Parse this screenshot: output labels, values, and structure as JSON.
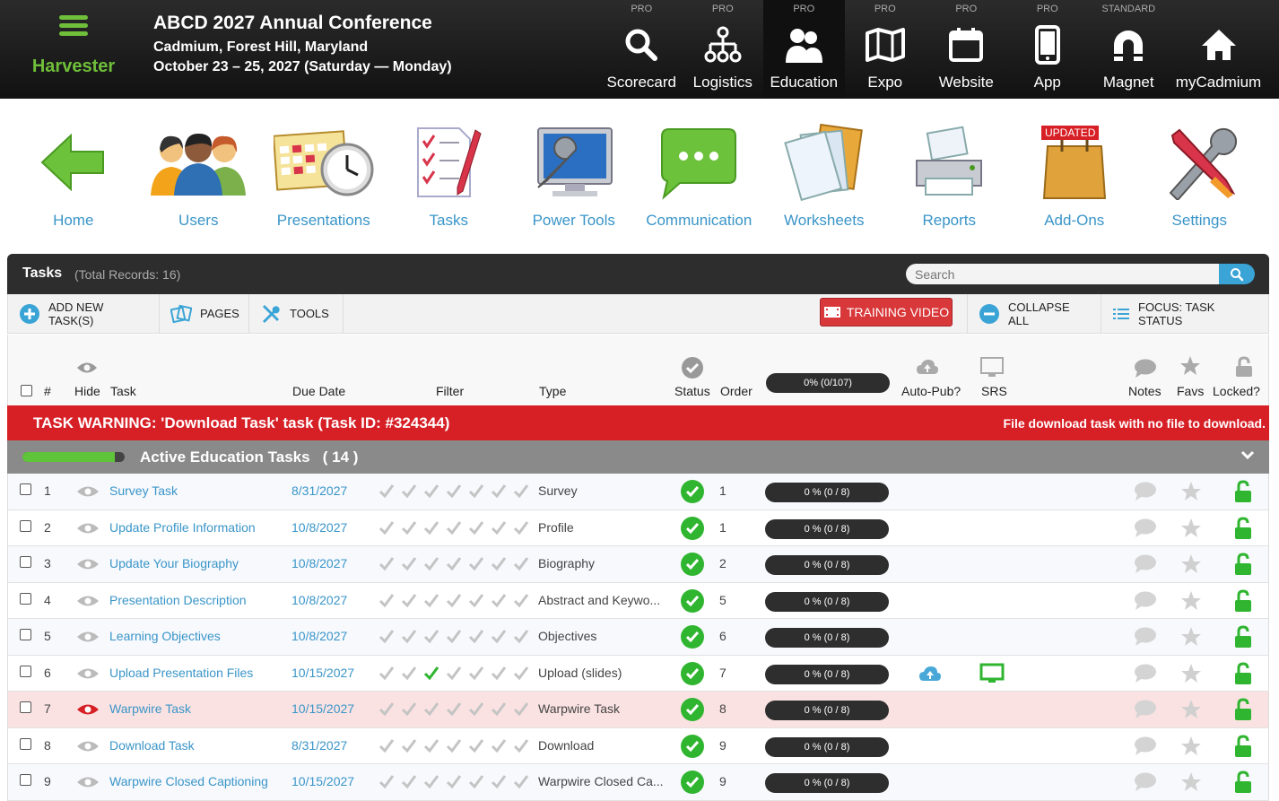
{
  "header": {
    "brand": "Harvester",
    "conference_title": "ABCD 2027 Annual Conference",
    "conference_location": "Cadmium, Forest Hill, Maryland",
    "conference_dates": "October 23 – 25, 2027 (Saturday — Monday)",
    "modules": [
      {
        "tier": "PRO",
        "label": "Scorecard",
        "icon": "search-icon"
      },
      {
        "tier": "PRO",
        "label": "Logistics",
        "icon": "org-chart-icon"
      },
      {
        "tier": "PRO",
        "label": "Education",
        "icon": "people-icon",
        "active": true
      },
      {
        "tier": "PRO",
        "label": "Expo",
        "icon": "map-icon"
      },
      {
        "tier": "PRO",
        "label": "Website",
        "icon": "calendar-icon"
      },
      {
        "tier": "PRO",
        "label": "App",
        "icon": "phone-icon"
      },
      {
        "tier": "STANDARD",
        "label": "Magnet",
        "icon": "magnet-icon"
      },
      {
        "tier": "",
        "label": "myCadmium",
        "icon": "home-icon"
      }
    ]
  },
  "appnav": {
    "items": [
      {
        "label": "Home",
        "icon": "back-arrow-icon"
      },
      {
        "label": "Users",
        "icon": "users-icon"
      },
      {
        "label": "Presentations",
        "icon": "calendar-clock-icon"
      },
      {
        "label": "Tasks",
        "icon": "checklist-icon"
      },
      {
        "label": "Power Tools",
        "icon": "monitor-wrench-icon"
      },
      {
        "label": "Communication",
        "icon": "chat-bubble-icon"
      },
      {
        "label": "Worksheets",
        "icon": "folders-icon"
      },
      {
        "label": "Reports",
        "icon": "printer-icon"
      },
      {
        "label": "Add-Ons",
        "icon": "shopping-bag-icon",
        "badge": "UPDATED"
      },
      {
        "label": "Settings",
        "icon": "tools-icon"
      }
    ]
  },
  "panel": {
    "title": "Tasks",
    "count": "(Total Records: 16)",
    "search_placeholder": "Search"
  },
  "toolbar": {
    "add": "ADD NEW TASK(S)",
    "pages": "PAGES",
    "tools": "TOOLS",
    "training": "TRAINING VIDEO",
    "collapse": "COLLAPSE ALL",
    "focus": "FOCUS: TASK STATUS"
  },
  "columns": {
    "num": "#",
    "hide": "Hide",
    "task": "Task",
    "due": "Due Date",
    "filter": "Filter",
    "type": "Type",
    "status": "Status",
    "order": "Order",
    "progress": "0% (0/107)",
    "autopub": "Auto-Pub?",
    "srs": "SRS",
    "notes": "Notes",
    "favs": "Favs",
    "locked": "Locked?"
  },
  "warning": {
    "text": "TASK WARNING: 'Download Task' task (Task ID: #324344)",
    "detail": "File download task with no file to download."
  },
  "group": {
    "label": "Active Education Tasks",
    "count": "( 14 )",
    "progress_fraction": 0.9
  },
  "colors": {
    "accent_blue": "#3a95c8",
    "green": "#2fb52f",
    "red": "#d71f26"
  },
  "rows": [
    {
      "num": "1",
      "task": "Survey Task",
      "due": "8/31/2027",
      "type": "Survey",
      "order": "1",
      "progress": "0 % (0 / 8)",
      "filter_checked": [],
      "autopub": false,
      "srs": false,
      "hidden": false
    },
    {
      "num": "2",
      "task": "Update Profile Information",
      "due": "10/8/2027",
      "type": "Profile",
      "order": "1",
      "progress": "0 % (0 / 8)",
      "filter_checked": [],
      "autopub": false,
      "srs": false,
      "hidden": false
    },
    {
      "num": "3",
      "task": "Update Your Biography",
      "due": "10/8/2027",
      "type": "Biography",
      "order": "2",
      "progress": "0 % (0 / 8)",
      "filter_checked": [],
      "autopub": false,
      "srs": false,
      "hidden": false
    },
    {
      "num": "4",
      "task": "Presentation Description",
      "due": "10/8/2027",
      "type": "Abstract and Keywo...",
      "order": "5",
      "progress": "0 % (0 / 8)",
      "filter_checked": [],
      "autopub": false,
      "srs": false,
      "hidden": false
    },
    {
      "num": "5",
      "task": "Learning Objectives",
      "due": "10/8/2027",
      "type": "Objectives",
      "order": "6",
      "progress": "0 % (0 / 8)",
      "filter_checked": [],
      "autopub": false,
      "srs": false,
      "hidden": false
    },
    {
      "num": "6",
      "task": "Upload Presentation Files",
      "due": "10/15/2027",
      "type": "Upload (slides)",
      "order": "7",
      "progress": "0 % (0 / 8)",
      "filter_checked": [
        2
      ],
      "autopub": true,
      "srs": true,
      "hidden": false
    },
    {
      "num": "7",
      "task": "Warpwire Task",
      "due": "10/15/2027",
      "type": "Warpwire Task",
      "order": "8",
      "progress": "0 % (0 / 8)",
      "filter_checked": [],
      "autopub": false,
      "srs": false,
      "hidden": true
    },
    {
      "num": "8",
      "task": "Download Task",
      "due": "8/31/2027",
      "type": "Download",
      "order": "9",
      "progress": "0 % (0 / 8)",
      "filter_checked": [],
      "autopub": false,
      "srs": false,
      "hidden": false
    },
    {
      "num": "9",
      "task": "Warpwire Closed Captioning",
      "due": "10/15/2027",
      "type": "Warpwire Closed Ca...",
      "order": "9",
      "progress": "0 % (0 / 8)",
      "filter_checked": [],
      "autopub": false,
      "srs": false,
      "hidden": false
    }
  ]
}
